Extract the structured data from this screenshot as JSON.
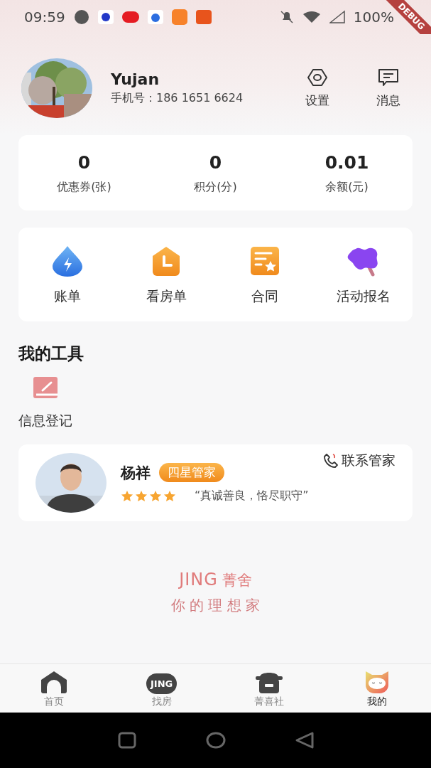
{
  "status_bar": {
    "time": "09:59",
    "battery": "100%",
    "debug_banner": "DEBUG"
  },
  "profile": {
    "name": "Yujan",
    "phone": "手机号：186 1651 6624",
    "actions": [
      {
        "label": "设置",
        "kind": "settings"
      },
      {
        "label": "消息",
        "kind": "message"
      }
    ]
  },
  "stats": [
    {
      "value": "0",
      "label": "优惠券(张)"
    },
    {
      "value": "0",
      "label": "积分(分)"
    },
    {
      "value": "0.01",
      "label": "余额(元)"
    }
  ],
  "shortcuts": [
    {
      "label": "账单",
      "kind": "bill"
    },
    {
      "label": "看房单",
      "kind": "viewing"
    },
    {
      "label": "合同",
      "kind": "contract"
    },
    {
      "label": "活动报名",
      "kind": "event"
    }
  ],
  "tools": {
    "title": "我的工具",
    "items": [
      {
        "label": "信息登记",
        "kind": "register"
      }
    ]
  },
  "manager": {
    "name": "杨祥",
    "badge": "四星管家",
    "stars": 4,
    "motto": "“真诚善良，恪尽职守”",
    "contact": "联系管家"
  },
  "brand": {
    "logo_latin": "JING",
    "logo_cn": "菁舍",
    "slogan": "你 的 理 想 家"
  },
  "tab_bar": [
    {
      "label": "首页",
      "kind": "home",
      "selected": false
    },
    {
      "label": "找房",
      "kind": "jing",
      "icon_text": "JING",
      "selected": false
    },
    {
      "label": "菁喜社",
      "kind": "pot",
      "selected": false
    },
    {
      "label": "我的",
      "kind": "cat",
      "selected": true
    }
  ]
}
